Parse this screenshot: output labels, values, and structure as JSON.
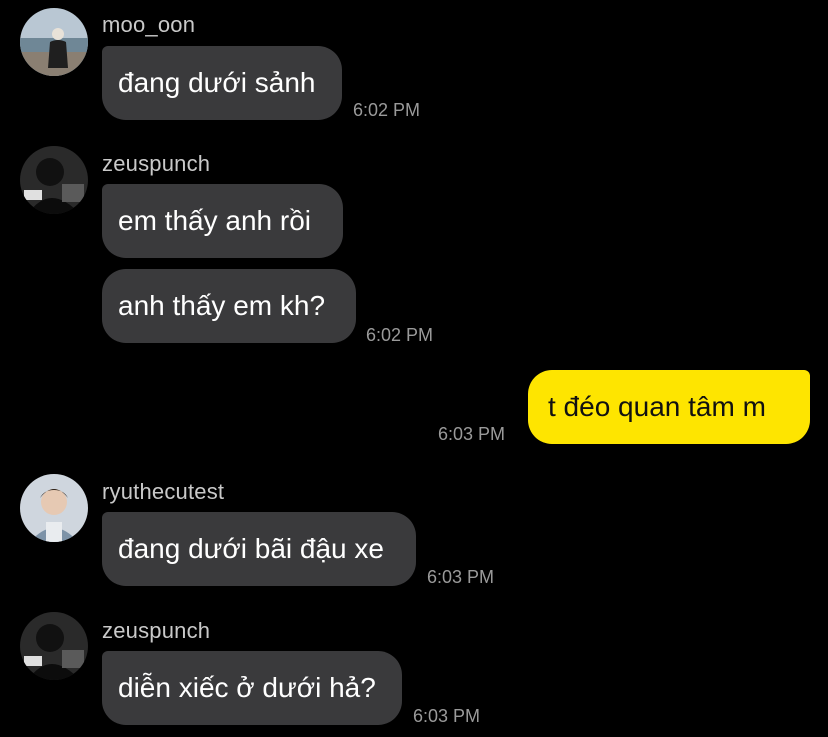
{
  "theme": {
    "background": "#000000",
    "incoming_bubble": "#3a3a3c",
    "outgoing_bubble": "#fee500",
    "username_color": "#c9c9c9",
    "time_color": "#9a9a9a"
  },
  "chat": {
    "groups": [
      {
        "sender": "moo_oon",
        "avatar": "avatar-photo-seaside",
        "messages": [
          "đang dưới sảnh"
        ],
        "time": "6:02 PM"
      },
      {
        "sender": "zeuspunch",
        "avatar": "avatar-photo-dark",
        "messages": [
          "em thấy anh rồi",
          "anh thấy em kh?"
        ],
        "time": "6:02 PM"
      },
      {
        "sender": "me",
        "outgoing": true,
        "messages": [
          "t đéo quan tâm m"
        ],
        "time": "6:03 PM"
      },
      {
        "sender": "ryuthecutest",
        "avatar": "avatar-photo-person",
        "messages": [
          "đang dưới bãi đậu xe"
        ],
        "time": "6:03 PM"
      },
      {
        "sender": "zeuspunch",
        "avatar": "avatar-photo-dark",
        "messages": [
          "diễn xiếc ở dưới hả?"
        ],
        "time": "6:03 PM"
      }
    ]
  }
}
